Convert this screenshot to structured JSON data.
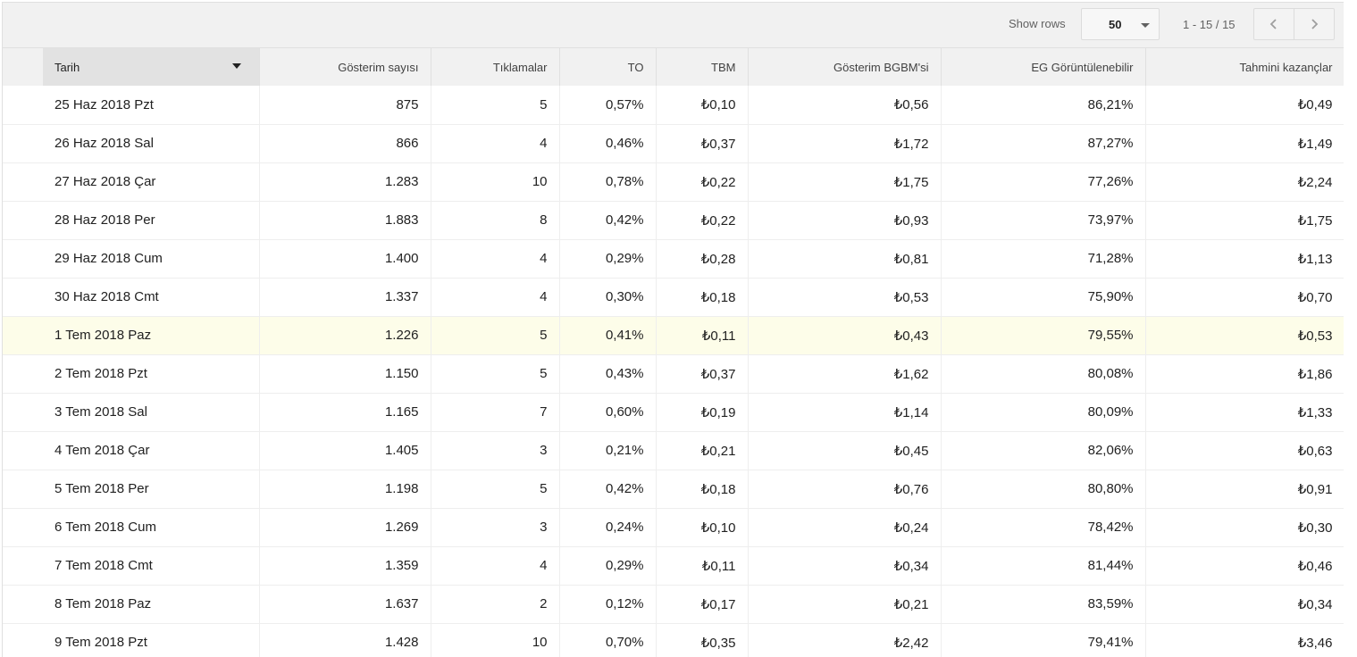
{
  "toolbar": {
    "show_rows_label": "Show rows",
    "rows_per_page": "50",
    "range": "1 - 15 / 15"
  },
  "table": {
    "headers": [
      "Tarih",
      "Gösterim sayısı",
      "Tıklamalar",
      "TO",
      "TBM",
      "Gösterim BGBM'si",
      "EG Görüntülenebilir",
      "Tahmini kazançlar"
    ],
    "sorted_column": "Tarih",
    "highlighted_row": 6,
    "rows": [
      [
        "25 Haz 2018 Pzt",
        "875",
        "5",
        "0,57%",
        "₺0,10",
        "₺0,56",
        "86,21%",
        "₺0,49"
      ],
      [
        "26 Haz 2018 Sal",
        "866",
        "4",
        "0,46%",
        "₺0,37",
        "₺1,72",
        "87,27%",
        "₺1,49"
      ],
      [
        "27 Haz 2018 Çar",
        "1.283",
        "10",
        "0,78%",
        "₺0,22",
        "₺1,75",
        "77,26%",
        "₺2,24"
      ],
      [
        "28 Haz 2018 Per",
        "1.883",
        "8",
        "0,42%",
        "₺0,22",
        "₺0,93",
        "73,97%",
        "₺1,75"
      ],
      [
        "29 Haz 2018 Cum",
        "1.400",
        "4",
        "0,29%",
        "₺0,28",
        "₺0,81",
        "71,28%",
        "₺1,13"
      ],
      [
        "30 Haz 2018 Cmt",
        "1.337",
        "4",
        "0,30%",
        "₺0,18",
        "₺0,53",
        "75,90%",
        "₺0,70"
      ],
      [
        "1 Tem 2018 Paz",
        "1.226",
        "5",
        "0,41%",
        "₺0,11",
        "₺0,43",
        "79,55%",
        "₺0,53"
      ],
      [
        "2 Tem 2018 Pzt",
        "1.150",
        "5",
        "0,43%",
        "₺0,37",
        "₺1,62",
        "80,08%",
        "₺1,86"
      ],
      [
        "3 Tem 2018 Sal",
        "1.165",
        "7",
        "0,60%",
        "₺0,19",
        "₺1,14",
        "80,09%",
        "₺1,33"
      ],
      [
        "4 Tem 2018 Çar",
        "1.405",
        "3",
        "0,21%",
        "₺0,21",
        "₺0,45",
        "82,06%",
        "₺0,63"
      ],
      [
        "5 Tem 2018 Per",
        "1.198",
        "5",
        "0,42%",
        "₺0,18",
        "₺0,76",
        "80,80%",
        "₺0,91"
      ],
      [
        "6 Tem 2018 Cum",
        "1.269",
        "3",
        "0,24%",
        "₺0,10",
        "₺0,24",
        "78,42%",
        "₺0,30"
      ],
      [
        "7 Tem 2018 Cmt",
        "1.359",
        "4",
        "0,29%",
        "₺0,11",
        "₺0,34",
        "81,44%",
        "₺0,46"
      ],
      [
        "8 Tem 2018 Paz",
        "1.637",
        "2",
        "0,12%",
        "₺0,17",
        "₺0,21",
        "83,59%",
        "₺0,34"
      ],
      [
        "9 Tem 2018 Pzt",
        "1.428",
        "10",
        "0,70%",
        "₺0,35",
        "₺2,42",
        "79,41%",
        "₺3,46"
      ]
    ]
  }
}
